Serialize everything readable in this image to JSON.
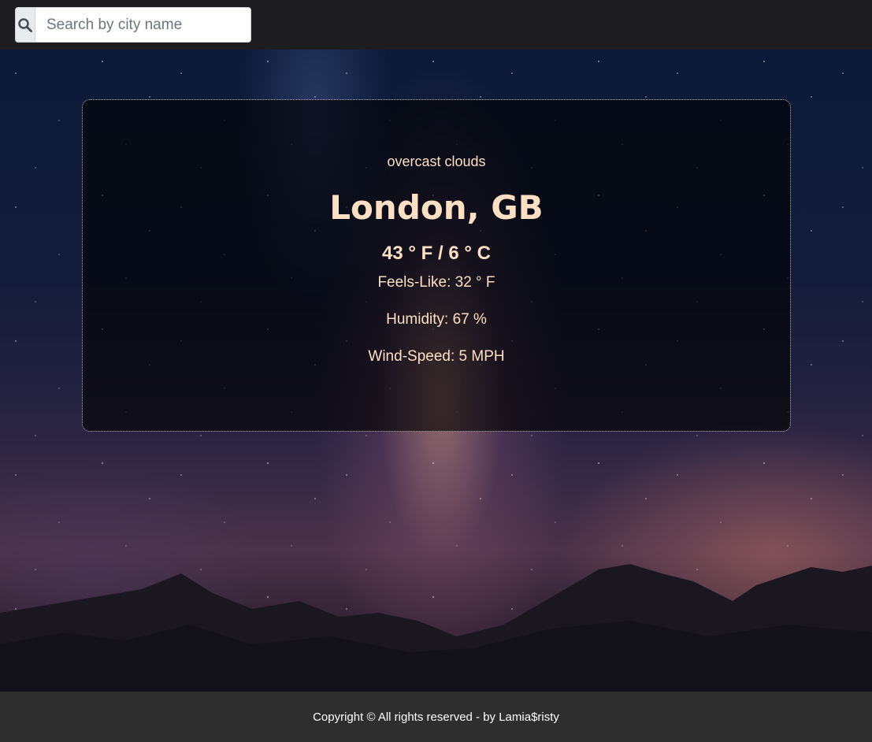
{
  "search": {
    "placeholder": "Search by city name",
    "icon": "search-icon"
  },
  "weather": {
    "description": "overcast clouds",
    "location": "London, GB",
    "temperature": "43 ° F / 6 ° C",
    "feels_like": "Feels-Like: 32 ° F",
    "humidity": "Humidity: 67 %",
    "wind_speed": "Wind-Speed: 5 MPH"
  },
  "footer": {
    "text": "Copyright © All rights reserved - by Lamia$risty"
  },
  "colors": {
    "topbar": "#1d1d1f",
    "card_text": "#fde0c4",
    "footer_bg": "#2e2e2e"
  }
}
